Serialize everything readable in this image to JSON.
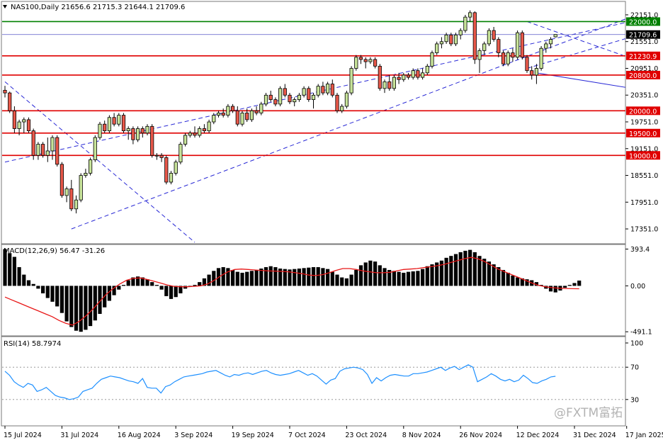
{
  "chart_data": {
    "type": "candlestick",
    "symbol_header": "NAS100,Daily  21656.6 21715.3 21644.1 21709.6",
    "header_ohlc": {
      "open": 21656.6,
      "high": 21715.3,
      "low": 21644.1,
      "close": 21709.6
    },
    "price_axis": {
      "ylim": [
        17050,
        22420
      ],
      "ticks": [
        22151.0,
        21551.0,
        20951.0,
        20351.0,
        19751.0,
        19151.0,
        18551.0,
        17951.0,
        17351.0
      ],
      "tick_labels": [
        "22151.0",
        "21551.0",
        "20951.0",
        "20351.0",
        "19751.0",
        "19151.0",
        "18551.0",
        "17951.0",
        "17351.0"
      ]
    },
    "x_axis": {
      "labels": [
        "15 Jul 2024",
        "31 Jul 2024",
        "16 Aug 2024",
        "3 Sep 2024",
        "19 Sep 2024",
        "7 Oct 2024",
        "23 Oct 2024",
        "8 Nov 2024",
        "26 Nov 2024",
        "12 Dec 2024",
        "31 Dec 2024",
        "17 Jan 2025"
      ],
      "label_bar_index": [
        0,
        12,
        24,
        36,
        48,
        60,
        72,
        84,
        96,
        108,
        120,
        131
      ]
    },
    "horizontal_levels": [
      {
        "label": "22000.0",
        "value": 22000.0,
        "color": "#008000"
      },
      {
        "label": "21230.9",
        "value": 21230.9,
        "color": "#e00000"
      },
      {
        "label": "20800.0",
        "value": 20800.0,
        "color": "#e00000"
      },
      {
        "label": "20000.0",
        "value": 20000.0,
        "color": "#e00000"
      },
      {
        "label": "19500.0",
        "value": 19500.0,
        "color": "#e00000"
      },
      {
        "label": "19000.0",
        "value": 19000.0,
        "color": "#e00000"
      }
    ],
    "current_price_label": "21709.6",
    "current_price": 21709.6,
    "trendlines": [
      {
        "style": "dashed",
        "color": "#2b2bd6",
        "from": [
          14,
          17350
        ],
        "to": [
          138,
          22350
        ]
      },
      {
        "style": "dashed",
        "color": "#2b2bd6",
        "from": [
          0,
          18850
        ],
        "to": [
          138,
          22150
        ]
      },
      {
        "style": "dashed",
        "color": "#2b2bd6",
        "from": [
          0,
          20650
        ],
        "to": [
          40,
          17050
        ]
      },
      {
        "style": "dashed",
        "color": "#2b2bd6",
        "from": [
          110,
          22000
        ],
        "to": [
          138,
          20950
        ]
      },
      {
        "style": "dashed",
        "color": "#2b2bd6",
        "from": [
          110,
          20950
        ],
        "to": [
          138,
          21850
        ]
      },
      {
        "style": "solid",
        "color": "#2b2bd6",
        "from": [
          112,
          20850
        ],
        "to": [
          138,
          20400
        ]
      }
    ],
    "candles": [
      [
        20460,
        20560,
        20300,
        20400
      ],
      [
        20400,
        20430,
        19950,
        20000
      ],
      [
        20000,
        20100,
        19500,
        19600
      ],
      [
        19600,
        19800,
        19450,
        19750
      ],
      [
        19750,
        19850,
        19500,
        19800
      ],
      [
        19800,
        19850,
        19500,
        19550
      ],
      [
        19550,
        19600,
        18900,
        19000
      ],
      [
        19000,
        19300,
        18900,
        19250
      ],
      [
        19250,
        19300,
        18950,
        19000
      ],
      [
        19000,
        19400,
        18850,
        19100
      ],
      [
        19100,
        19450,
        18900,
        19400
      ],
      [
        19400,
        19450,
        18750,
        18800
      ],
      [
        18800,
        18850,
        18050,
        18100
      ],
      [
        18100,
        18300,
        17950,
        18250
      ],
      [
        18250,
        18450,
        17750,
        17800
      ],
      [
        17800,
        18100,
        17700,
        18000
      ],
      [
        18000,
        18600,
        17950,
        18550
      ],
      [
        18550,
        18700,
        18500,
        18600
      ],
      [
        18600,
        18950,
        18550,
        18900
      ],
      [
        18900,
        19450,
        18850,
        19400
      ],
      [
        19400,
        19750,
        19350,
        19700
      ],
      [
        19700,
        19780,
        19500,
        19550
      ],
      [
        19550,
        19900,
        19500,
        19850
      ],
      [
        19850,
        19950,
        19650,
        19700
      ],
      [
        19700,
        19950,
        19650,
        19900
      ],
      [
        19900,
        19950,
        19500,
        19550
      ],
      [
        19550,
        19650,
        19350,
        19600
      ],
      [
        19600,
        19650,
        19250,
        19350
      ],
      [
        19350,
        19650,
        19300,
        19600
      ],
      [
        19600,
        19650,
        19400,
        19500
      ],
      [
        19500,
        19700,
        19450,
        19650
      ],
      [
        19650,
        19700,
        18950,
        19000
      ],
      [
        19000,
        19050,
        18900,
        19000
      ],
      [
        19000,
        19050,
        18850,
        18950
      ],
      [
        18950,
        19000,
        18350,
        18400
      ],
      [
        18400,
        18650,
        18350,
        18600
      ],
      [
        18600,
        18900,
        18550,
        18850
      ],
      [
        18850,
        19300,
        18800,
        19250
      ],
      [
        19250,
        19500,
        19200,
        19450
      ],
      [
        19450,
        19550,
        19400,
        19500
      ],
      [
        19500,
        19650,
        19400,
        19450
      ],
      [
        19450,
        19650,
        19400,
        19600
      ],
      [
        19600,
        19700,
        19500,
        19550
      ],
      [
        19550,
        19800,
        19500,
        19750
      ],
      [
        19750,
        19950,
        19700,
        19900
      ],
      [
        19900,
        20000,
        19850,
        19950
      ],
      [
        19950,
        20050,
        19850,
        19900
      ],
      [
        19900,
        20150,
        19850,
        20100
      ],
      [
        20100,
        20150,
        19950,
        20000
      ],
      [
        20000,
        20100,
        19650,
        19700
      ],
      [
        19700,
        20000,
        19650,
        19950
      ],
      [
        19950,
        20050,
        19750,
        19800
      ],
      [
        19800,
        20050,
        19750,
        20000
      ],
      [
        20000,
        20100,
        19900,
        19950
      ],
      [
        19950,
        20200,
        19900,
        20150
      ],
      [
        20150,
        20400,
        20100,
        20350
      ],
      [
        20350,
        20450,
        20200,
        20250
      ],
      [
        20250,
        20300,
        20100,
        20150
      ],
      [
        20150,
        20550,
        20100,
        20500
      ],
      [
        20500,
        20600,
        20300,
        20350
      ],
      [
        20350,
        20400,
        20150,
        20200
      ],
      [
        20200,
        20300,
        20100,
        20250
      ],
      [
        20250,
        20400,
        20200,
        20350
      ],
      [
        20350,
        20550,
        20300,
        20500
      ],
      [
        20500,
        20550,
        20200,
        20250
      ],
      [
        20250,
        20400,
        20050,
        20350
      ],
      [
        20350,
        20600,
        20300,
        20550
      ],
      [
        20550,
        20650,
        20350,
        20400
      ],
      [
        20400,
        20650,
        20350,
        20600
      ],
      [
        20600,
        20700,
        20300,
        20350
      ],
      [
        20350,
        20400,
        19950,
        20000
      ],
      [
        20000,
        20150,
        19950,
        20100
      ],
      [
        20100,
        20450,
        20050,
        20400
      ],
      [
        20400,
        21000,
        20350,
        20950
      ],
      [
        20950,
        21250,
        20900,
        21200
      ],
      [
        21200,
        21250,
        21050,
        21150
      ],
      [
        21150,
        21200,
        20950,
        21100
      ],
      [
        21100,
        21200,
        21050,
        21150
      ],
      [
        21150,
        21200,
        20950,
        21000
      ],
      [
        21000,
        21050,
        20450,
        20500
      ],
      [
        20500,
        20700,
        20400,
        20650
      ],
      [
        20650,
        20800,
        20450,
        20500
      ],
      [
        20500,
        20800,
        20450,
        20750
      ],
      [
        20750,
        20850,
        20600,
        20700
      ],
      [
        20700,
        20850,
        20650,
        20800
      ],
      [
        20800,
        20850,
        20700,
        20750
      ],
      [
        20750,
        20950,
        20700,
        20900
      ],
      [
        20900,
        20950,
        20700,
        20750
      ],
      [
        20750,
        20950,
        20700,
        20850
      ],
      [
        20850,
        21050,
        20800,
        21000
      ],
      [
        21000,
        21350,
        20950,
        21300
      ],
      [
        21300,
        21550,
        21250,
        21500
      ],
      [
        21500,
        21650,
        21400,
        21550
      ],
      [
        21550,
        21750,
        21500,
        21700
      ],
      [
        21700,
        21750,
        21450,
        21500
      ],
      [
        21500,
        21750,
        21450,
        21700
      ],
      [
        21700,
        21850,
        21600,
        21800
      ],
      [
        21800,
        22150,
        21750,
        22100
      ],
      [
        22100,
        22250,
        22000,
        22200
      ],
      [
        22200,
        22230,
        21050,
        21150
      ],
      [
        21150,
        21400,
        20850,
        21350
      ],
      [
        21350,
        21550,
        21250,
        21500
      ],
      [
        21500,
        21850,
        21450,
        21800
      ],
      [
        21800,
        21880,
        21550,
        21600
      ],
      [
        21600,
        21650,
        21200,
        21300
      ],
      [
        21300,
        21350,
        21000,
        21050
      ],
      [
        21050,
        21350,
        21000,
        21300
      ],
      [
        21300,
        21400,
        21100,
        21200
      ],
      [
        21200,
        21800,
        21150,
        21750
      ],
      [
        21750,
        21800,
        21150,
        21200
      ],
      [
        21200,
        21250,
        20850,
        20900
      ],
      [
        20900,
        21000,
        20700,
        20800
      ],
      [
        20800,
        21050,
        20600,
        20950
      ],
      [
        20950,
        21450,
        20900,
        21400
      ],
      [
        21400,
        21550,
        21300,
        21500
      ],
      [
        21500,
        21650,
        21400,
        21600
      ],
      [
        21656.6,
        21715.3,
        21644.1,
        21709.6
      ]
    ],
    "macd": {
      "label": "MACD(12,26,9) 56.47 -31.26",
      "main": 56.47,
      "signal": -31.26,
      "ylim": [
        -520,
        420
      ],
      "ticks": [
        393.4,
        0.0,
        -491.1
      ],
      "tick_labels": [
        "393.4",
        "0.00",
        "-491.1"
      ],
      "histogram": [
        393.4,
        350,
        310,
        200,
        120,
        60,
        20,
        -30,
        -80,
        -130,
        -170,
        -220,
        -290,
        -380,
        -440,
        -480,
        -491.1,
        -470,
        -430,
        -370,
        -300,
        -230,
        -160,
        -100,
        -40,
        10,
        60,
        90,
        100,
        90,
        70,
        40,
        10,
        -40,
        -110,
        -140,
        -120,
        -80,
        -30,
        -10,
        10,
        40,
        80,
        120,
        160,
        190,
        200,
        190,
        170,
        150,
        140,
        150,
        160,
        170,
        185,
        200,
        210,
        200,
        185,
        180,
        175,
        180,
        185,
        190,
        195,
        200,
        200,
        190,
        180,
        150,
        120,
        90,
        80,
        120,
        170,
        220,
        250,
        270,
        260,
        220,
        190,
        170,
        160,
        150,
        140,
        150,
        155,
        160,
        180,
        210,
        230,
        250,
        270,
        300,
        320,
        340,
        360,
        375,
        385,
        360,
        320,
        290,
        260,
        230,
        200,
        170,
        140,
        110,
        90,
        80,
        70,
        60,
        40,
        10,
        -30,
        -60,
        -70,
        -50,
        -20,
        10,
        30,
        56.47
      ],
      "signal_line": [
        -120,
        -150,
        -180,
        -210,
        -240,
        -270,
        -300,
        -330,
        -370,
        -400,
        -420,
        -380,
        -320,
        -250,
        -170,
        -90,
        -30,
        20,
        60,
        80,
        85,
        70,
        50,
        30,
        10,
        -5,
        -10,
        -10,
        -5,
        0,
        20,
        60,
        110,
        150,
        175,
        180,
        175,
        170,
        165,
        160,
        158,
        155,
        150,
        140,
        130,
        115,
        110,
        120,
        140,
        165,
        185,
        185,
        175,
        160,
        150,
        140,
        140,
        145,
        160,
        175,
        180,
        185,
        195,
        205,
        215,
        230,
        250,
        270,
        290,
        305,
        290,
        260,
        220,
        180,
        150,
        120,
        90,
        60,
        30,
        5,
        -10,
        -20,
        -25,
        -28,
        -30,
        -31.26
      ]
    },
    "rsi": {
      "label": "RSI(14) 58.7974",
      "value": 58.7974,
      "ylim": [
        0,
        100
      ],
      "ticks": [
        100,
        70,
        50,
        30,
        0
      ],
      "tick_labels": [
        "100",
        "70",
        "50",
        "30",
        "0"
      ],
      "levels": [
        70,
        30
      ],
      "values": [
        65,
        60,
        52,
        48,
        45,
        50,
        48,
        40,
        42,
        45,
        40,
        35,
        33,
        32,
        30,
        31,
        33,
        40,
        42,
        44,
        50,
        55,
        57,
        59,
        58,
        57,
        55,
        53,
        52,
        50,
        56,
        45,
        44,
        44,
        38,
        46,
        48,
        52,
        55,
        58,
        59,
        60,
        61,
        62,
        64,
        65,
        66,
        63,
        60,
        58,
        61,
        60,
        62,
        63,
        61,
        63,
        65,
        66,
        63,
        61,
        60,
        61,
        62,
        64,
        66,
        63,
        60,
        62,
        59,
        54,
        49,
        54,
        56,
        65,
        68,
        69,
        70,
        69,
        67,
        61,
        50,
        57,
        53,
        57,
        60,
        61,
        60,
        59,
        59,
        62,
        62,
        63,
        64,
        66,
        68,
        70,
        66,
        69,
        71,
        67,
        70,
        73,
        70,
        52,
        55,
        58,
        62,
        59,
        55,
        53,
        55,
        52,
        54,
        60,
        56,
        51,
        50,
        53,
        55,
        58,
        58.7974
      ]
    }
  },
  "watermark": {
    "text": "@FXTM富拓"
  }
}
